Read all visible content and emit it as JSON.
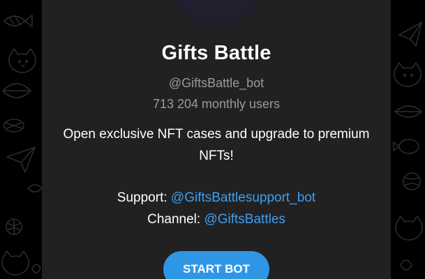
{
  "bot": {
    "name": "Gifts Battle",
    "username": "@GiftsBattle_bot",
    "monthly_users": "713 204 monthly users",
    "description": "Open exclusive NFT cases and upgrade to premium NFTs!"
  },
  "support": {
    "label": "Support:",
    "link": "@GiftsBattlesupport_bot"
  },
  "channel": {
    "label": "Channel:",
    "link": "@GiftsBattles"
  },
  "actions": {
    "start_label": "START BOT"
  },
  "colors": {
    "background": "#000000",
    "card": "#212121",
    "link": "#3e9ff0",
    "button": "#2f96e6",
    "muted_text": "#9a9a9a"
  },
  "icons": [
    "cat-doodle",
    "fish-doodle",
    "paper-plane-doodle",
    "yarn-ball-doodle",
    "leaf-doodle"
  ]
}
